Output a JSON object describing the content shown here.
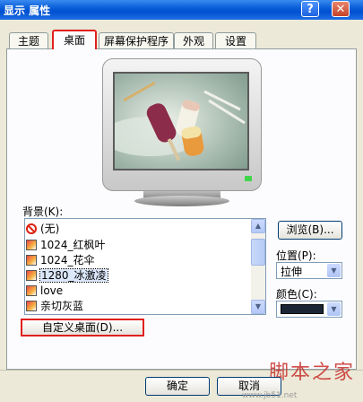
{
  "window": {
    "title": "显示 属性",
    "help_glyph": "?",
    "close_glyph": "✕"
  },
  "tabs": [
    {
      "label": "主题",
      "active": false
    },
    {
      "label": "桌面",
      "active": true
    },
    {
      "label": "屏幕保护程序",
      "active": false
    },
    {
      "label": "外观",
      "active": false
    },
    {
      "label": "设置",
      "active": false
    }
  ],
  "background": {
    "label": "背景(K):",
    "items": [
      {
        "label": "(无)",
        "icon": "none-icon"
      },
      {
        "label": "1024_红枫叶",
        "icon": "image-file-icon"
      },
      {
        "label": "1024_花伞",
        "icon": "image-file-icon"
      },
      {
        "label": "1280_冰激凌",
        "icon": "image-file-icon",
        "selected": true
      },
      {
        "label": "love",
        "icon": "image-file-icon"
      },
      {
        "label": "亲切灰蓝",
        "icon": "image-file-icon"
      }
    ],
    "browse_label": "浏览(B)...",
    "custom_label": "自定义桌面(D)..."
  },
  "position": {
    "label": "位置(P):",
    "value": "拉伸"
  },
  "color": {
    "label": "颜色(C):",
    "value_hex": "#1b2535"
  },
  "footer": {
    "ok_label": "确定",
    "cancel_label": "取消",
    "site_text": "www.jb51.net"
  },
  "watermark": {
    "text": "脚本之家"
  },
  "colors": {
    "tab_highlight": "#e0201e",
    "titlebar": "#0a5fd8"
  }
}
